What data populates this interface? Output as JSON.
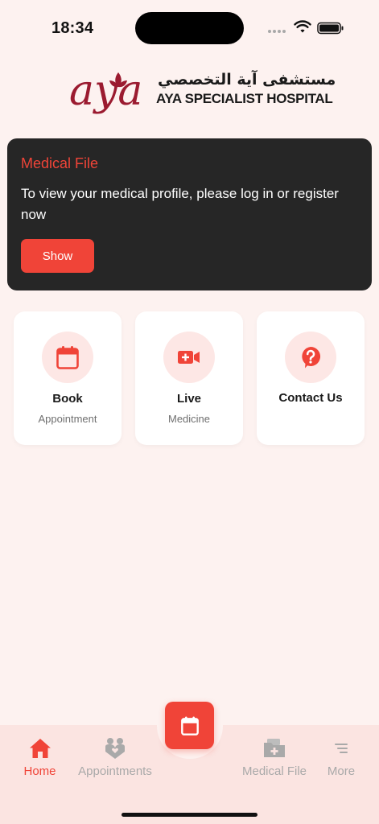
{
  "status_bar": {
    "time": "18:34"
  },
  "logo": {
    "script": "aya",
    "arabic_name": "مستشفى آية التخصصي",
    "english_name": "AYA SPECIALIST HOSPITAL"
  },
  "medical_file_card": {
    "title": "Medical File",
    "message": "To view your medical profile, please log in or register now",
    "button_label": "Show"
  },
  "quick_actions": [
    {
      "title": "Book",
      "subtitle": "Appointment",
      "icon": "calendar-icon"
    },
    {
      "title": "Live",
      "subtitle": "Medicine",
      "icon": "video-medical-icon"
    },
    {
      "title": "Contact Us",
      "subtitle": "",
      "icon": "question-chat-icon"
    }
  ],
  "bottom_nav": {
    "items": [
      {
        "label": "Home",
        "icon": "home-icon",
        "active": true
      },
      {
        "label": "Appointments",
        "icon": "appointments-icon",
        "active": false
      },
      {
        "label": "Medical File",
        "icon": "medical-folder-icon",
        "active": false
      },
      {
        "label": "More",
        "icon": "menu-lines-icon",
        "active": false
      }
    ],
    "center_button_icon": "calendar-icon"
  },
  "colors": {
    "accent": "#f04438",
    "background": "#fdf2f0",
    "card_dark": "#262626",
    "icon_circle": "#fde7e5",
    "nav_background": "#fbe4e1",
    "logo_maroon": "#9b1b30"
  }
}
